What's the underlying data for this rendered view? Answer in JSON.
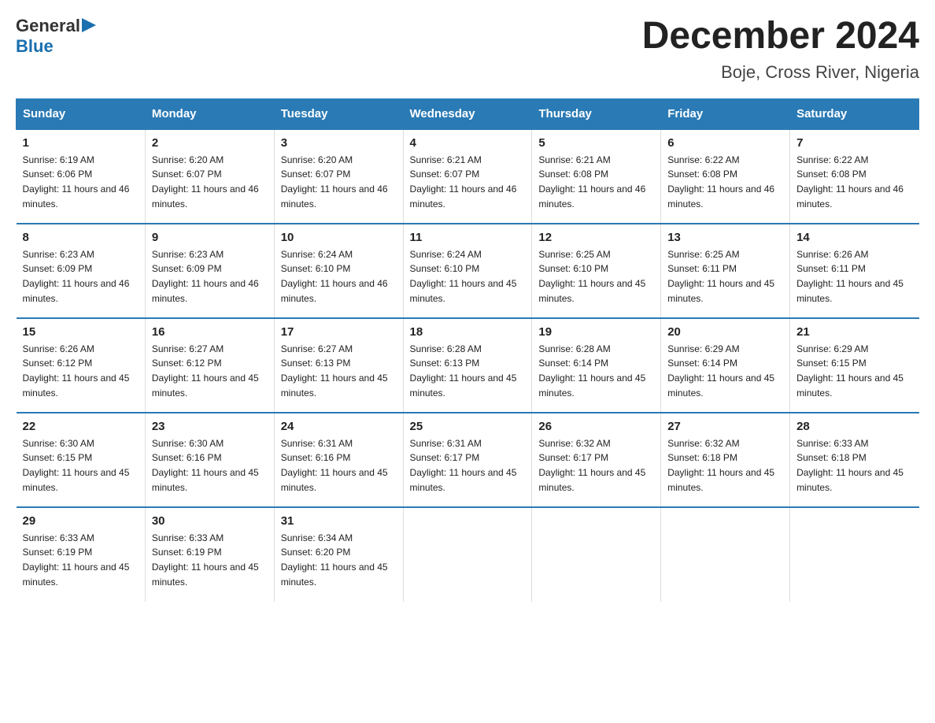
{
  "header": {
    "logo_general": "General",
    "logo_blue": "Blue",
    "month_title": "December 2024",
    "location": "Boje, Cross River, Nigeria"
  },
  "calendar": {
    "days_of_week": [
      "Sunday",
      "Monday",
      "Tuesday",
      "Wednesday",
      "Thursday",
      "Friday",
      "Saturday"
    ],
    "weeks": [
      [
        {
          "day": "1",
          "sunrise": "6:19 AM",
          "sunset": "6:06 PM",
          "daylight": "11 hours and 46 minutes."
        },
        {
          "day": "2",
          "sunrise": "6:20 AM",
          "sunset": "6:07 PM",
          "daylight": "11 hours and 46 minutes."
        },
        {
          "day": "3",
          "sunrise": "6:20 AM",
          "sunset": "6:07 PM",
          "daylight": "11 hours and 46 minutes."
        },
        {
          "day": "4",
          "sunrise": "6:21 AM",
          "sunset": "6:07 PM",
          "daylight": "11 hours and 46 minutes."
        },
        {
          "day": "5",
          "sunrise": "6:21 AM",
          "sunset": "6:08 PM",
          "daylight": "11 hours and 46 minutes."
        },
        {
          "day": "6",
          "sunrise": "6:22 AM",
          "sunset": "6:08 PM",
          "daylight": "11 hours and 46 minutes."
        },
        {
          "day": "7",
          "sunrise": "6:22 AM",
          "sunset": "6:08 PM",
          "daylight": "11 hours and 46 minutes."
        }
      ],
      [
        {
          "day": "8",
          "sunrise": "6:23 AM",
          "sunset": "6:09 PM",
          "daylight": "11 hours and 46 minutes."
        },
        {
          "day": "9",
          "sunrise": "6:23 AM",
          "sunset": "6:09 PM",
          "daylight": "11 hours and 46 minutes."
        },
        {
          "day": "10",
          "sunrise": "6:24 AM",
          "sunset": "6:10 PM",
          "daylight": "11 hours and 46 minutes."
        },
        {
          "day": "11",
          "sunrise": "6:24 AM",
          "sunset": "6:10 PM",
          "daylight": "11 hours and 45 minutes."
        },
        {
          "day": "12",
          "sunrise": "6:25 AM",
          "sunset": "6:10 PM",
          "daylight": "11 hours and 45 minutes."
        },
        {
          "day": "13",
          "sunrise": "6:25 AM",
          "sunset": "6:11 PM",
          "daylight": "11 hours and 45 minutes."
        },
        {
          "day": "14",
          "sunrise": "6:26 AM",
          "sunset": "6:11 PM",
          "daylight": "11 hours and 45 minutes."
        }
      ],
      [
        {
          "day": "15",
          "sunrise": "6:26 AM",
          "sunset": "6:12 PM",
          "daylight": "11 hours and 45 minutes."
        },
        {
          "day": "16",
          "sunrise": "6:27 AM",
          "sunset": "6:12 PM",
          "daylight": "11 hours and 45 minutes."
        },
        {
          "day": "17",
          "sunrise": "6:27 AM",
          "sunset": "6:13 PM",
          "daylight": "11 hours and 45 minutes."
        },
        {
          "day": "18",
          "sunrise": "6:28 AM",
          "sunset": "6:13 PM",
          "daylight": "11 hours and 45 minutes."
        },
        {
          "day": "19",
          "sunrise": "6:28 AM",
          "sunset": "6:14 PM",
          "daylight": "11 hours and 45 minutes."
        },
        {
          "day": "20",
          "sunrise": "6:29 AM",
          "sunset": "6:14 PM",
          "daylight": "11 hours and 45 minutes."
        },
        {
          "day": "21",
          "sunrise": "6:29 AM",
          "sunset": "6:15 PM",
          "daylight": "11 hours and 45 minutes."
        }
      ],
      [
        {
          "day": "22",
          "sunrise": "6:30 AM",
          "sunset": "6:15 PM",
          "daylight": "11 hours and 45 minutes."
        },
        {
          "day": "23",
          "sunrise": "6:30 AM",
          "sunset": "6:16 PM",
          "daylight": "11 hours and 45 minutes."
        },
        {
          "day": "24",
          "sunrise": "6:31 AM",
          "sunset": "6:16 PM",
          "daylight": "11 hours and 45 minutes."
        },
        {
          "day": "25",
          "sunrise": "6:31 AM",
          "sunset": "6:17 PM",
          "daylight": "11 hours and 45 minutes."
        },
        {
          "day": "26",
          "sunrise": "6:32 AM",
          "sunset": "6:17 PM",
          "daylight": "11 hours and 45 minutes."
        },
        {
          "day": "27",
          "sunrise": "6:32 AM",
          "sunset": "6:18 PM",
          "daylight": "11 hours and 45 minutes."
        },
        {
          "day": "28",
          "sunrise": "6:33 AM",
          "sunset": "6:18 PM",
          "daylight": "11 hours and 45 minutes."
        }
      ],
      [
        {
          "day": "29",
          "sunrise": "6:33 AM",
          "sunset": "6:19 PM",
          "daylight": "11 hours and 45 minutes."
        },
        {
          "day": "30",
          "sunrise": "6:33 AM",
          "sunset": "6:19 PM",
          "daylight": "11 hours and 45 minutes."
        },
        {
          "day": "31",
          "sunrise": "6:34 AM",
          "sunset": "6:20 PM",
          "daylight": "11 hours and 45 minutes."
        },
        null,
        null,
        null,
        null
      ]
    ]
  }
}
